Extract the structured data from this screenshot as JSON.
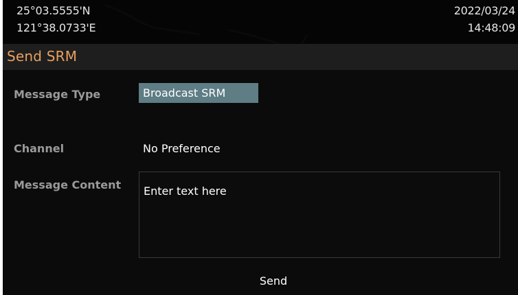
{
  "status": {
    "latitude": "25°03.5555'N",
    "longitude": "121°38.0733'E",
    "date": "2022/03/24",
    "time": "14:48:09"
  },
  "page": {
    "title": "Send SRM"
  },
  "form": {
    "message_type_label": "Message Type",
    "message_type_value": "Broadcast SRM",
    "channel_label": "Channel",
    "channel_value": "No Preference",
    "message_content_label": "Message Content",
    "message_content_placeholder": "Enter text here",
    "send_label": "Send"
  },
  "colors": {
    "title": "#e8a060",
    "highlight": "#5e7d85",
    "background": "#0b0b0b"
  }
}
